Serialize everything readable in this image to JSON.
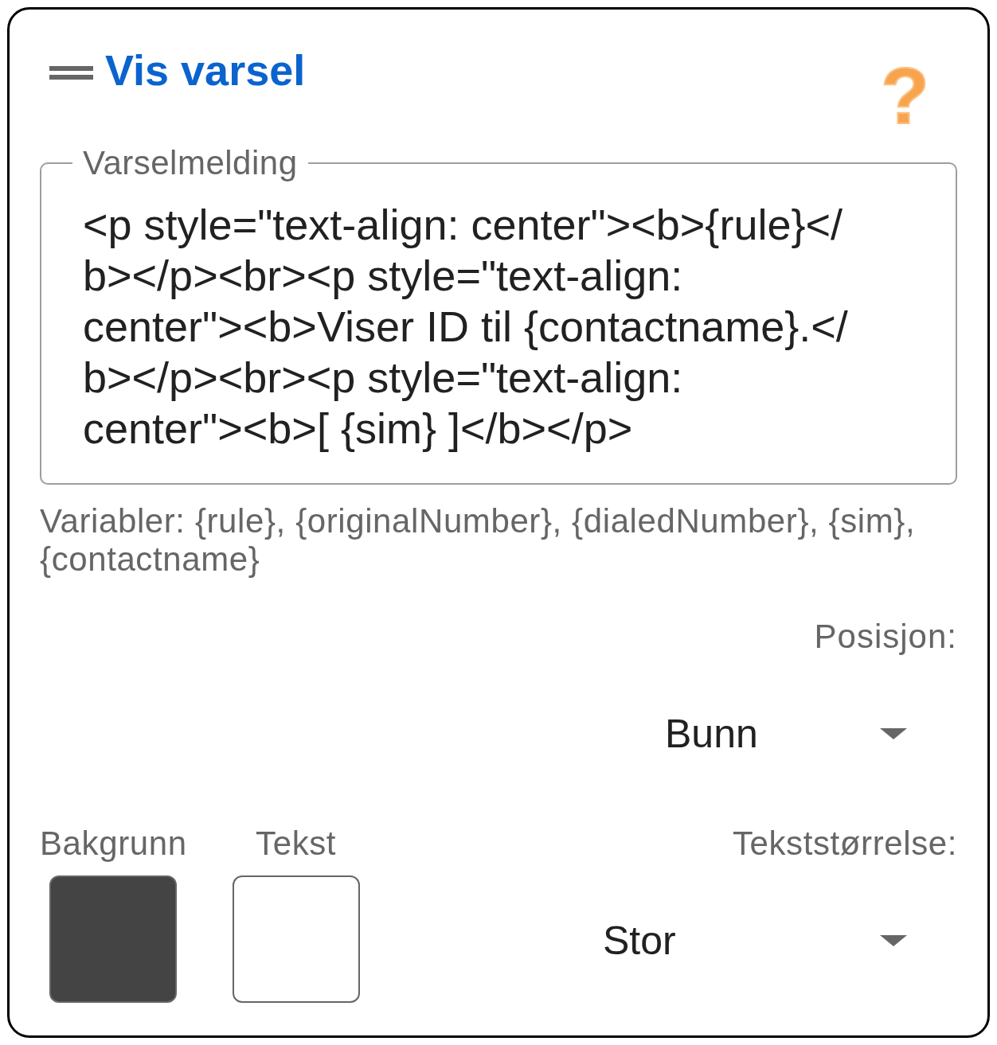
{
  "title": "Vis varsel",
  "help": "?",
  "message_field": {
    "label": "Varselmelding",
    "value": "<p style=\"text-align: center\"><b>{rule}</b></p><br><p style=\"text-align: center\"><b>Viser ID til {contactname}.</b></p><br><p style=\"text-align: center\"><b>[ {sim} ]</b></p>",
    "helper": "Variabler: {rule}, {originalNumber}, {dialedNumber}, {sim}, {contactname}"
  },
  "position": {
    "label": "Posisjon:",
    "value": "Bunn"
  },
  "colors": [
    {
      "label": "Bakgrunn",
      "color": "#444444"
    },
    {
      "label": "Tekst",
      "color": "#ffffff"
    }
  ],
  "text_size": {
    "label": "Tekststørrelse:",
    "value": "Stor"
  }
}
